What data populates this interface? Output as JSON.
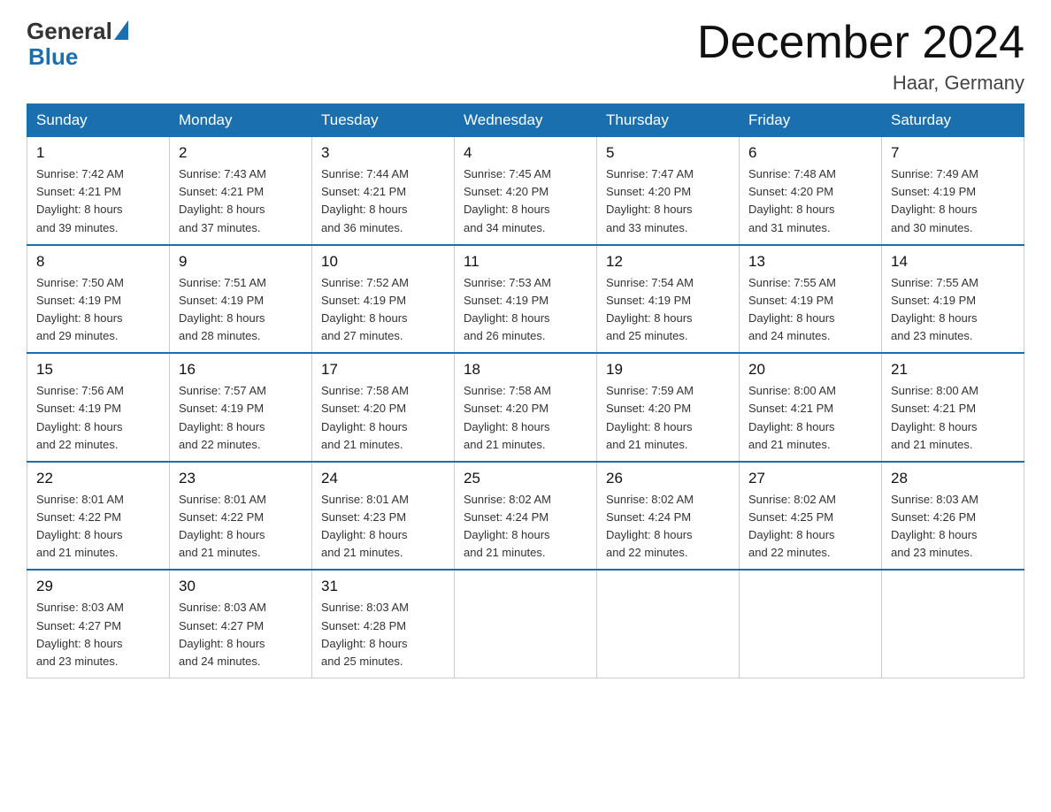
{
  "header": {
    "logo_general": "General",
    "logo_blue": "Blue",
    "month_title": "December 2024",
    "location": "Haar, Germany"
  },
  "days_of_week": [
    "Sunday",
    "Monday",
    "Tuesday",
    "Wednesday",
    "Thursday",
    "Friday",
    "Saturday"
  ],
  "weeks": [
    [
      {
        "day": "1",
        "sunrise": "7:42 AM",
        "sunset": "4:21 PM",
        "daylight": "8 hours and 39 minutes."
      },
      {
        "day": "2",
        "sunrise": "7:43 AM",
        "sunset": "4:21 PM",
        "daylight": "8 hours and 37 minutes."
      },
      {
        "day": "3",
        "sunrise": "7:44 AM",
        "sunset": "4:21 PM",
        "daylight": "8 hours and 36 minutes."
      },
      {
        "day": "4",
        "sunrise": "7:45 AM",
        "sunset": "4:20 PM",
        "daylight": "8 hours and 34 minutes."
      },
      {
        "day": "5",
        "sunrise": "7:47 AM",
        "sunset": "4:20 PM",
        "daylight": "8 hours and 33 minutes."
      },
      {
        "day": "6",
        "sunrise": "7:48 AM",
        "sunset": "4:20 PM",
        "daylight": "8 hours and 31 minutes."
      },
      {
        "day": "7",
        "sunrise": "7:49 AM",
        "sunset": "4:19 PM",
        "daylight": "8 hours and 30 minutes."
      }
    ],
    [
      {
        "day": "8",
        "sunrise": "7:50 AM",
        "sunset": "4:19 PM",
        "daylight": "8 hours and 29 minutes."
      },
      {
        "day": "9",
        "sunrise": "7:51 AM",
        "sunset": "4:19 PM",
        "daylight": "8 hours and 28 minutes."
      },
      {
        "day": "10",
        "sunrise": "7:52 AM",
        "sunset": "4:19 PM",
        "daylight": "8 hours and 27 minutes."
      },
      {
        "day": "11",
        "sunrise": "7:53 AM",
        "sunset": "4:19 PM",
        "daylight": "8 hours and 26 minutes."
      },
      {
        "day": "12",
        "sunrise": "7:54 AM",
        "sunset": "4:19 PM",
        "daylight": "8 hours and 25 minutes."
      },
      {
        "day": "13",
        "sunrise": "7:55 AM",
        "sunset": "4:19 PM",
        "daylight": "8 hours and 24 minutes."
      },
      {
        "day": "14",
        "sunrise": "7:55 AM",
        "sunset": "4:19 PM",
        "daylight": "8 hours and 23 minutes."
      }
    ],
    [
      {
        "day": "15",
        "sunrise": "7:56 AM",
        "sunset": "4:19 PM",
        "daylight": "8 hours and 22 minutes."
      },
      {
        "day": "16",
        "sunrise": "7:57 AM",
        "sunset": "4:19 PM",
        "daylight": "8 hours and 22 minutes."
      },
      {
        "day": "17",
        "sunrise": "7:58 AM",
        "sunset": "4:20 PM",
        "daylight": "8 hours and 21 minutes."
      },
      {
        "day": "18",
        "sunrise": "7:58 AM",
        "sunset": "4:20 PM",
        "daylight": "8 hours and 21 minutes."
      },
      {
        "day": "19",
        "sunrise": "7:59 AM",
        "sunset": "4:20 PM",
        "daylight": "8 hours and 21 minutes."
      },
      {
        "day": "20",
        "sunrise": "8:00 AM",
        "sunset": "4:21 PM",
        "daylight": "8 hours and 21 minutes."
      },
      {
        "day": "21",
        "sunrise": "8:00 AM",
        "sunset": "4:21 PM",
        "daylight": "8 hours and 21 minutes."
      }
    ],
    [
      {
        "day": "22",
        "sunrise": "8:01 AM",
        "sunset": "4:22 PM",
        "daylight": "8 hours and 21 minutes."
      },
      {
        "day": "23",
        "sunrise": "8:01 AM",
        "sunset": "4:22 PM",
        "daylight": "8 hours and 21 minutes."
      },
      {
        "day": "24",
        "sunrise": "8:01 AM",
        "sunset": "4:23 PM",
        "daylight": "8 hours and 21 minutes."
      },
      {
        "day": "25",
        "sunrise": "8:02 AM",
        "sunset": "4:24 PM",
        "daylight": "8 hours and 21 minutes."
      },
      {
        "day": "26",
        "sunrise": "8:02 AM",
        "sunset": "4:24 PM",
        "daylight": "8 hours and 22 minutes."
      },
      {
        "day": "27",
        "sunrise": "8:02 AM",
        "sunset": "4:25 PM",
        "daylight": "8 hours and 22 minutes."
      },
      {
        "day": "28",
        "sunrise": "8:03 AM",
        "sunset": "4:26 PM",
        "daylight": "8 hours and 23 minutes."
      }
    ],
    [
      {
        "day": "29",
        "sunrise": "8:03 AM",
        "sunset": "4:27 PM",
        "daylight": "8 hours and 23 minutes."
      },
      {
        "day": "30",
        "sunrise": "8:03 AM",
        "sunset": "4:27 PM",
        "daylight": "8 hours and 24 minutes."
      },
      {
        "day": "31",
        "sunrise": "8:03 AM",
        "sunset": "4:28 PM",
        "daylight": "8 hours and 25 minutes."
      },
      null,
      null,
      null,
      null
    ]
  ],
  "labels": {
    "sunrise": "Sunrise:",
    "sunset": "Sunset:",
    "daylight": "Daylight:"
  }
}
